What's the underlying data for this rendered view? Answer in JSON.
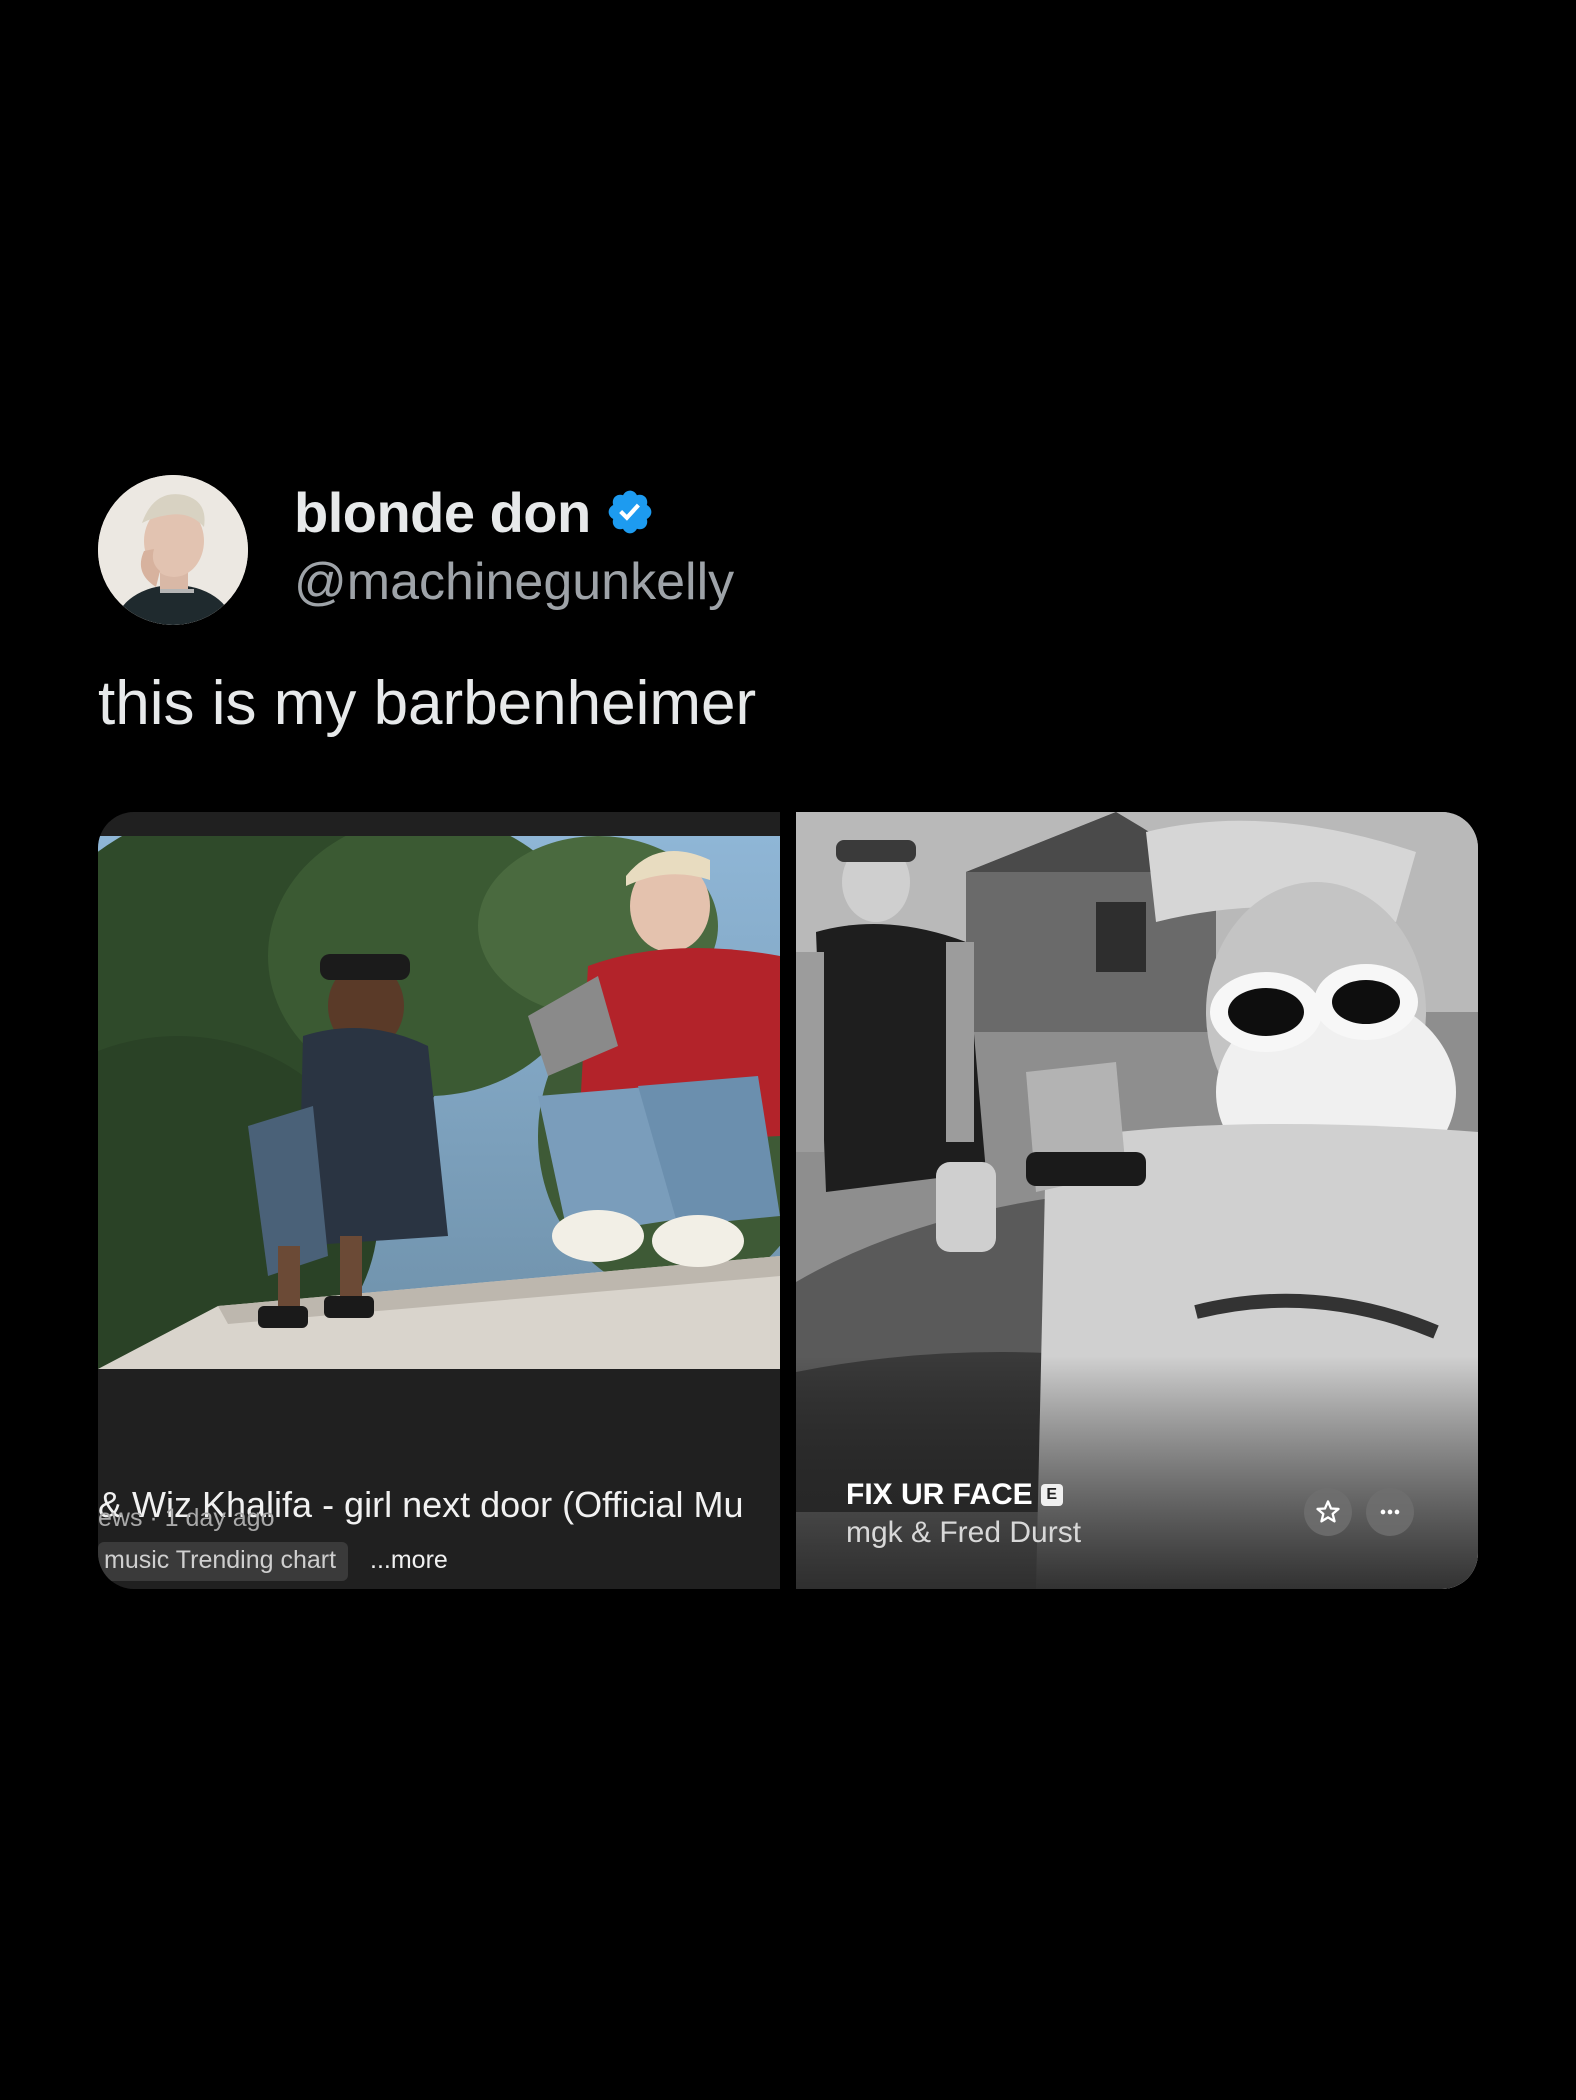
{
  "tweet": {
    "display_name": "blonde don",
    "handle": "@machinegunkelly",
    "text": "this is my barbenheimer"
  },
  "media": {
    "left": {
      "title": "& Wiz Khalifa - girl next door (Official Mu\n)",
      "title_line1": "& Wiz Khalifa - girl next door (Official Mu",
      "title_line2": ")",
      "meta": "ews · 1 day ago",
      "chart": "music Trending chart",
      "more": "...more"
    },
    "right": {
      "song_title": "FIX UR FACE",
      "explicit_badge": "E",
      "artist": "mgk & Fred Durst"
    }
  },
  "icons": {
    "verified": "verified-badge-icon",
    "star": "star-icon",
    "more": "more-options-icon"
  },
  "colors": {
    "background": "#000000",
    "text": "#e7e9ea",
    "muted": "#9ea3a8",
    "verified": "#1d9bf0"
  }
}
